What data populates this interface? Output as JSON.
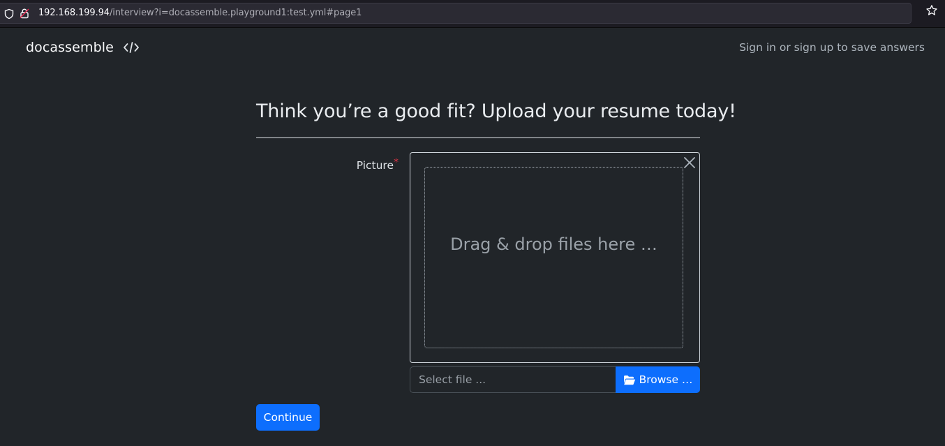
{
  "browser": {
    "url_host": "192.168.199.94",
    "url_path": "/interview?i=docassemble.playground1:test.yml#page1",
    "icons": {
      "shield": "shield-icon",
      "lock": "lock-icon",
      "bookmark": "star-icon"
    }
  },
  "navbar": {
    "brand": "docassemble",
    "source_icon": "code-icon",
    "signin_label": "Sign in or sign up to save answers"
  },
  "question": {
    "title": "Think you’re a good fit? Upload your resume today!",
    "field_label": "Picture",
    "required_marker": "*",
    "drop_zone_text": "Drag & drop files here …",
    "file_placeholder": "Select file ...",
    "browse_label": "Browse …",
    "continue_label": "Continue"
  },
  "colors": {
    "background": "#212529",
    "primary": "#0d6efd",
    "required": "#dc3545"
  }
}
